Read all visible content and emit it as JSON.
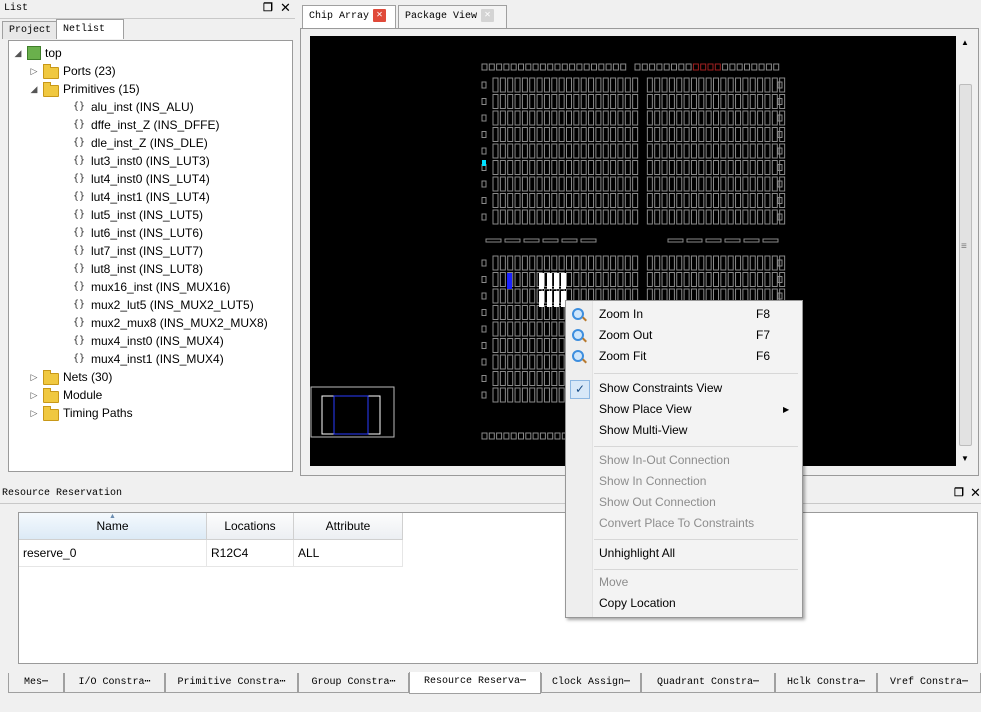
{
  "list_panel": {
    "title": "List",
    "tabs": [
      "Project",
      "Netlist"
    ],
    "active_tab": "Netlist",
    "tree": {
      "root": "top",
      "nodes": [
        {
          "label": "Ports (23)",
          "expanded": false
        },
        {
          "label": "Primitives (15)",
          "expanded": true,
          "children": [
            "alu_inst  (INS_ALU)",
            "dffe_inst_Z  (INS_DFFE)",
            "dle_inst_Z  (INS_DLE)",
            "lut3_inst0  (INS_LUT3)",
            "lut4_inst0  (INS_LUT4)",
            "lut4_inst1  (INS_LUT4)",
            "lut5_inst  (INS_LUT5)",
            "lut6_inst  (INS_LUT6)",
            "lut7_inst  (INS_LUT7)",
            "lut8_inst  (INS_LUT8)",
            "mux16_inst  (INS_MUX16)",
            "mux2_lut5  (INS_MUX2_LUT5)",
            "mux2_mux8  (INS_MUX2_MUX8)",
            "mux4_inst0  (INS_MUX4)",
            "mux4_inst1  (INS_MUX4)"
          ]
        },
        {
          "label": "Nets (30)",
          "expanded": false
        },
        {
          "label": "Module",
          "expanded": false
        },
        {
          "label": "Timing Paths",
          "expanded": false
        }
      ]
    }
  },
  "chip_tabs": [
    {
      "label": "Chip Array",
      "active": true,
      "close": "red"
    },
    {
      "label": "Package View",
      "active": false,
      "close": "grey"
    }
  ],
  "context_menu": {
    "items": [
      {
        "label": "Zoom In",
        "shortcut": "F8",
        "icon": "zoom-in-icon",
        "enabled": true
      },
      {
        "label": "Zoom Out",
        "shortcut": "F7",
        "icon": "zoom-out-icon",
        "enabled": true
      },
      {
        "label": "Zoom Fit",
        "shortcut": "F6",
        "icon": "zoom-fit-icon",
        "enabled": true
      },
      {
        "separator": true
      },
      {
        "label": "Show Constraints View",
        "checked": true,
        "enabled": true
      },
      {
        "label": "Show Place View",
        "submenu": true,
        "enabled": true
      },
      {
        "label": "Show Multi-View",
        "enabled": true
      },
      {
        "separator": true
      },
      {
        "label": "Show In-Out Connection",
        "enabled": false
      },
      {
        "label": "Show In Connection",
        "enabled": false
      },
      {
        "label": "Show Out Connection",
        "enabled": false
      },
      {
        "label": "Convert Place To Constraints",
        "enabled": false
      },
      {
        "separator": true
      },
      {
        "label": "Unhighlight All",
        "enabled": true
      },
      {
        "separator": true
      },
      {
        "label": "Move",
        "enabled": false
      },
      {
        "label": "Copy Location",
        "enabled": true
      }
    ]
  },
  "resource_reservation": {
    "title": "Resource Reservation",
    "columns": [
      "Name",
      "Locations",
      "Attribute"
    ],
    "rows": [
      [
        "reserve_0",
        "R12C4",
        "ALL"
      ]
    ]
  },
  "bottom_tabs": [
    "Mes⋯",
    "I/O Constra⋯",
    "Primitive Constra⋯",
    "Group Constra⋯",
    "Resource Reserva⋯",
    "Clock Assign⋯",
    "Quadrant Constra⋯",
    "Hclk Constra⋯",
    "Vref Constra⋯"
  ],
  "active_bottom_tab": "Resource Reserva⋯",
  "icons": {
    "window_float": "float-window-icon",
    "close": "close-icon",
    "sort": "sort-up-icon"
  },
  "colors": {
    "chip_background": "#000000",
    "highlight_cyan": "#00e0ff",
    "highlight_blue": "#1a22ff",
    "selection_white": "#ffffff"
  }
}
